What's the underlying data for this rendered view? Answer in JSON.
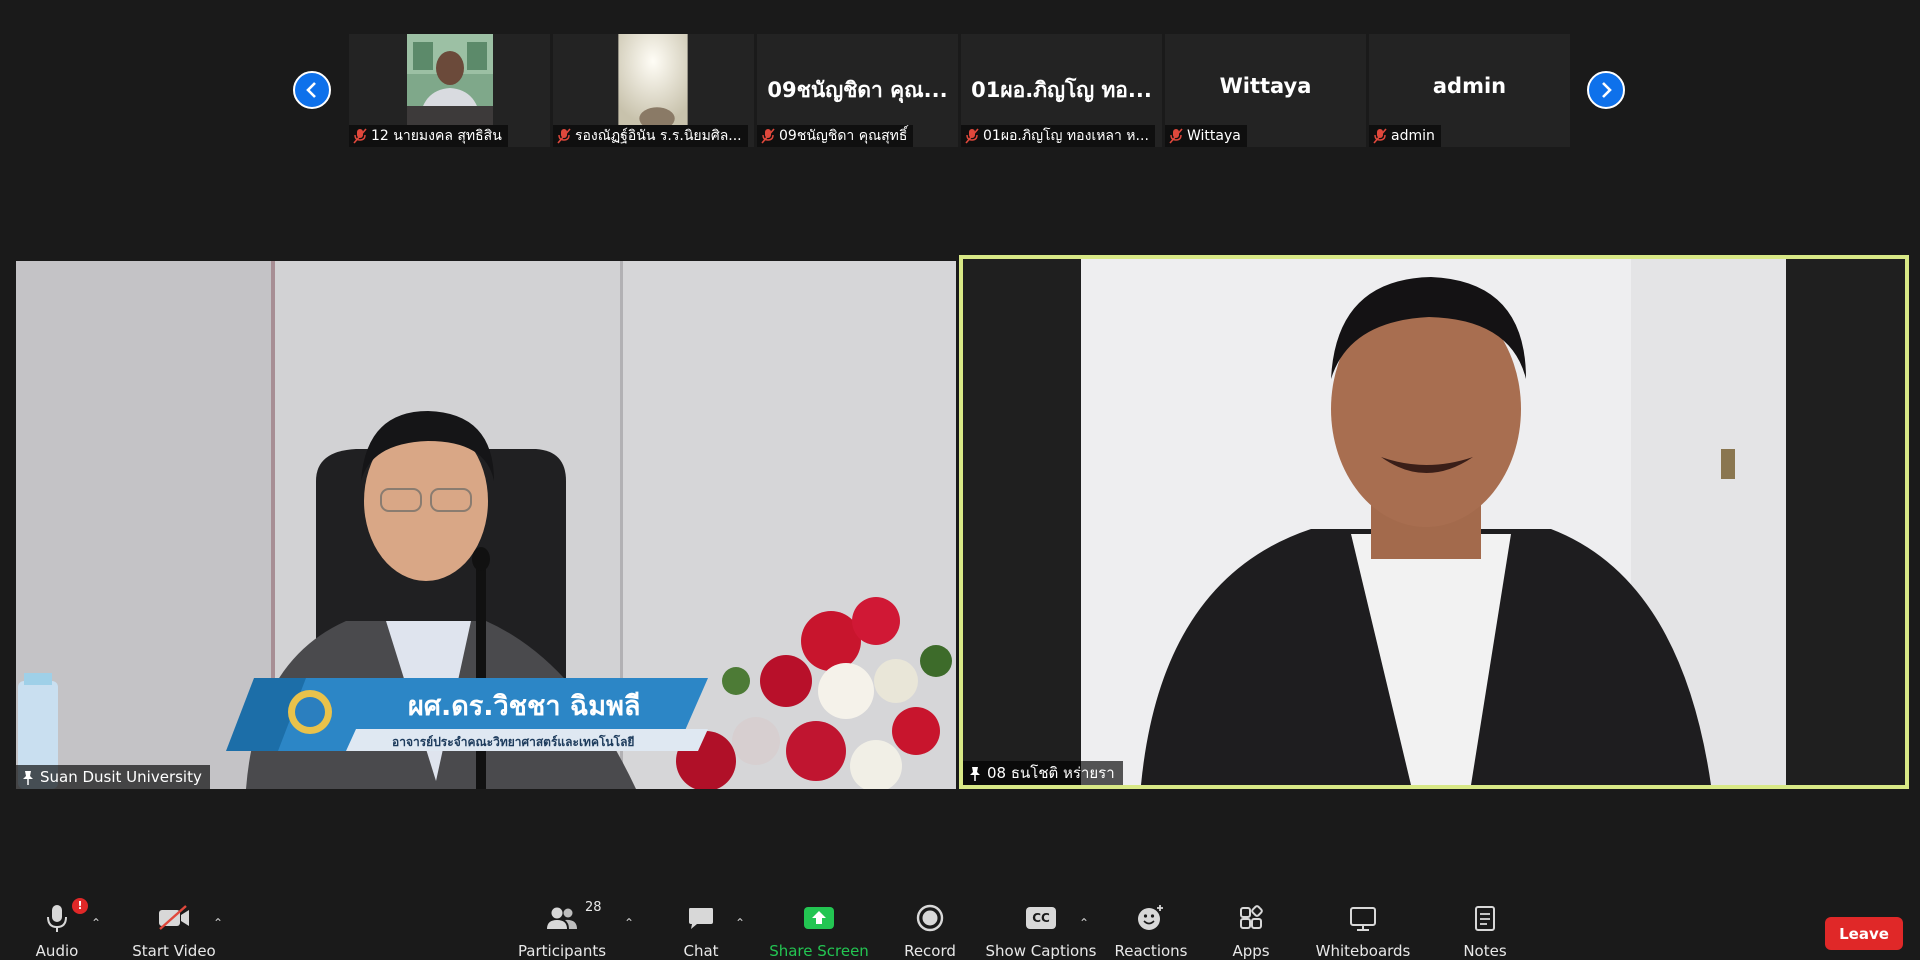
{
  "participants_strip": [
    {
      "label": "12 นายมงคล สุทธิสิน",
      "has_video": true
    },
    {
      "label": "รองณัฏฐ์อินัน  ร.ร.นิยมศิล...",
      "has_video": true
    },
    {
      "big_name": "09ชนัญชิดา  คุณ...",
      "label": "09ชนัญชิดา  คุณสุทธิ์"
    },
    {
      "big_name": "01ผอ.ภิญโญ  ทอ...",
      "label": "01ผอ.ภิญโญ  ทองเหลา ห..."
    },
    {
      "big_name": "Wittaya",
      "label": "Wittaya"
    },
    {
      "big_name": "admin",
      "label": "admin"
    }
  ],
  "main_videos": {
    "left": {
      "name": "Suan Dusit University",
      "lower_third_name": "ผศ.ดร.วิชชา ฉิมพลี",
      "lower_third_title": "อาจารย์ประจำคณะวิทยาศาสตร์และเทคโนโลยี"
    },
    "right": {
      "name": "08 ธนโชติ  หร่ายรา"
    }
  },
  "toolbar": {
    "audio": "Audio",
    "audio_badge": "!",
    "start_video": "Start Video",
    "participants": "Participants",
    "participants_count": "28",
    "chat": "Chat",
    "share_screen": "Share Screen",
    "record": "Record",
    "show_captions": "Show Captions",
    "cc_text": "CC",
    "reactions": "Reactions",
    "apps": "Apps",
    "whiteboards": "Whiteboards",
    "notes": "Notes",
    "leave": "Leave",
    "caret": "⌃"
  },
  "colors": {
    "background": "#1a1a1a",
    "active_speaker_border": "#d8e886",
    "share_green": "#23c552",
    "leave_red": "#e02828",
    "nav_blue": "#0e71eb"
  }
}
